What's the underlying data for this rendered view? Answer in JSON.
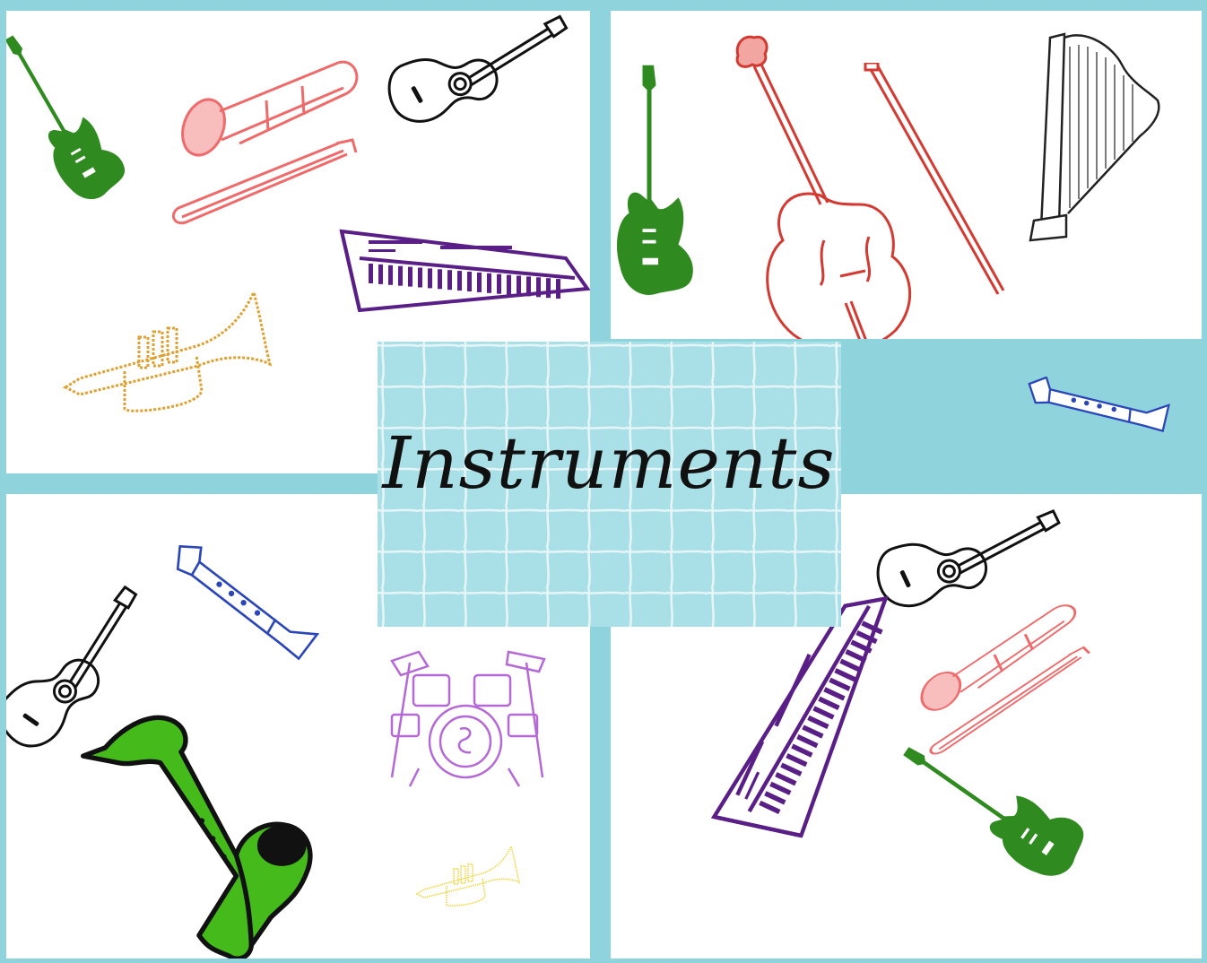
{
  "title": {
    "text": "Instruments"
  },
  "colors": {
    "frame": "#8fd3dc",
    "tile": "#a9dfe6",
    "tile_line": "#e9f7f9",
    "electric_guitar": "#2f8a20",
    "trombone": "#ef6a6a",
    "acoustic_guitar": "#111111",
    "keyboard": "#5a1f86",
    "trumpet": "#e0a030",
    "cello": "#d23a32",
    "harp": "#222222",
    "recorder": "#2a46b8",
    "saxophone": "#44bb1a",
    "drums": "#b569d6",
    "trumpet_small": "#f1d43a"
  },
  "panels": [
    {
      "name": "top-left",
      "icons": [
        "electric-guitar-icon",
        "trombone-icon",
        "acoustic-guitar-icon",
        "keyboard-icon",
        "trumpet-icon"
      ]
    },
    {
      "name": "top-right",
      "icons": [
        "electric-guitar-icon",
        "cello-icon",
        "bow-icon",
        "harp-icon",
        "recorder-icon"
      ]
    },
    {
      "name": "bottom-left",
      "icons": [
        "acoustic-guitar-icon",
        "recorder-icon",
        "drum-kit-icon",
        "saxophone-icon",
        "trumpet-icon"
      ]
    },
    {
      "name": "bottom-right",
      "icons": [
        "acoustic-guitar-icon",
        "trombone-icon",
        "keyboard-icon",
        "electric-guitar-icon"
      ]
    }
  ]
}
